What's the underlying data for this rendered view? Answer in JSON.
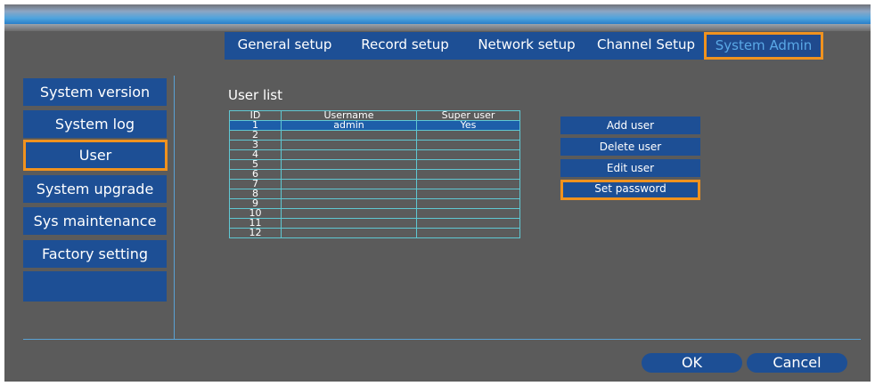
{
  "tabs": [
    {
      "label": "General setup"
    },
    {
      "label": "Record setup"
    },
    {
      "label": "Network setup"
    },
    {
      "label": "Channel Setup"
    },
    {
      "label": "System Admin"
    }
  ],
  "sidebar": {
    "items": [
      {
        "label": "System version"
      },
      {
        "label": "System log"
      },
      {
        "label": "User"
      },
      {
        "label": "System upgrade"
      },
      {
        "label": "Sys maintenance"
      },
      {
        "label": "Factory setting"
      },
      {
        "label": ""
      }
    ]
  },
  "user_list": {
    "title": "User list",
    "headers": {
      "id": "ID",
      "username": "Username",
      "super_user": "Super user"
    },
    "rows": [
      {
        "id": "1",
        "username": "admin",
        "super_user": "Yes"
      },
      {
        "id": "2",
        "username": "",
        "super_user": ""
      },
      {
        "id": "3",
        "username": "",
        "super_user": ""
      },
      {
        "id": "4",
        "username": "",
        "super_user": ""
      },
      {
        "id": "5",
        "username": "",
        "super_user": ""
      },
      {
        "id": "6",
        "username": "",
        "super_user": ""
      },
      {
        "id": "7",
        "username": "",
        "super_user": ""
      },
      {
        "id": "8",
        "username": "",
        "super_user": ""
      },
      {
        "id": "9",
        "username": "",
        "super_user": ""
      },
      {
        "id": "10",
        "username": "",
        "super_user": ""
      },
      {
        "id": "11",
        "username": "",
        "super_user": ""
      },
      {
        "id": "12",
        "username": "",
        "super_user": ""
      }
    ]
  },
  "actions": {
    "add_user": "Add user",
    "delete_user": "Delete user",
    "edit_user": "Edit user",
    "set_password": "Set password"
  },
  "footer": {
    "ok": "OK",
    "cancel": "Cancel"
  },
  "colors": {
    "panel_bg": "#5b5b5b",
    "button_blue": "#1d4f95",
    "highlight_orange": "#f0921e",
    "grid_cyan": "#5fc7d2",
    "selected_row": "#1d5ea9"
  }
}
